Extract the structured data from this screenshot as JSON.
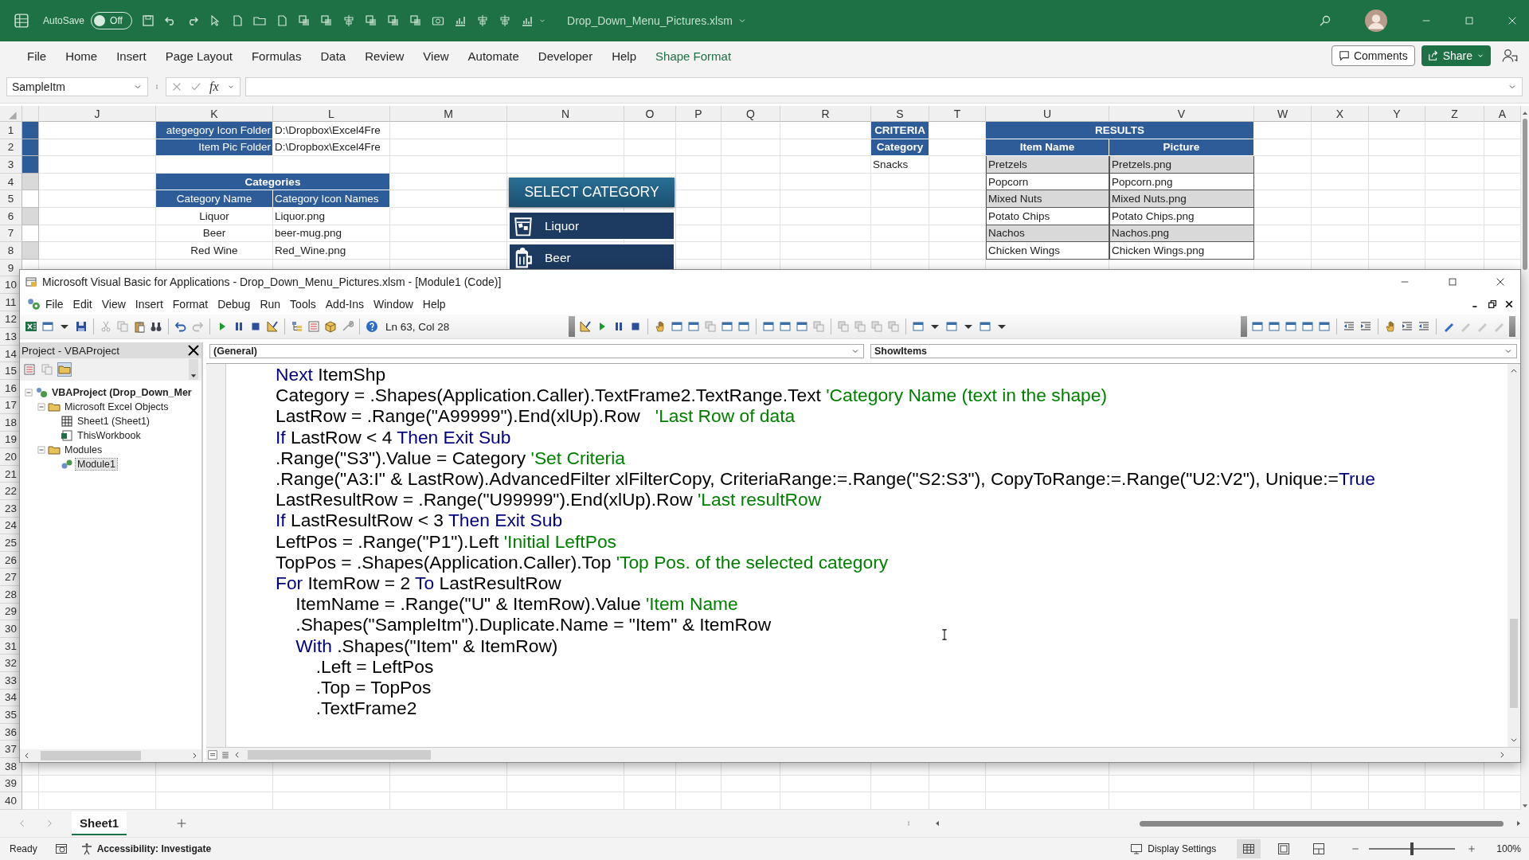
{
  "excel_window": {
    "autosave_label": "AutoSave",
    "autosave_state": "Off",
    "autosave_on": false,
    "file_name": "Drop_Down_Menu_Pictures.xlsm"
  },
  "ribbon_tabs": [
    {
      "label": "File",
      "kind": "standard"
    },
    {
      "label": "Home",
      "kind": "standard"
    },
    {
      "label": "Insert",
      "kind": "standard"
    },
    {
      "label": "Page Layout",
      "kind": "standard"
    },
    {
      "label": "Formulas",
      "kind": "standard"
    },
    {
      "label": "Data",
      "kind": "standard"
    },
    {
      "label": "Review",
      "kind": "standard"
    },
    {
      "label": "View",
      "kind": "standard"
    },
    {
      "label": "Automate",
      "kind": "standard"
    },
    {
      "label": "Developer",
      "kind": "standard"
    },
    {
      "label": "Help",
      "kind": "standard"
    },
    {
      "label": "Shape Format",
      "kind": "contextual"
    }
  ],
  "ribbon_buttons": {
    "comments": "Comments",
    "share": "Share"
  },
  "formula_bar": {
    "name_box": "SampleItm",
    "function_label": "fx"
  },
  "column_headers": [
    "J",
    "K",
    "L",
    "M",
    "N",
    "O",
    "P",
    "Q",
    "R",
    "S",
    "T",
    "U",
    "V",
    "W",
    "X",
    "Y",
    "Z",
    "A"
  ],
  "row_numbers": [
    "1",
    "2",
    "3",
    "4",
    "5",
    "6",
    "7",
    "8",
    "9",
    "10",
    "11",
    "12",
    "13",
    "14",
    "15",
    "16",
    "17",
    "18",
    "19",
    "20",
    "21",
    "22",
    "23",
    "24",
    "25",
    "26",
    "27",
    "28",
    "29",
    "30",
    "31",
    "32",
    "33",
    "34",
    "35",
    "36",
    "37",
    "38",
    "39",
    "40"
  ],
  "column_i_cells": [
    {
      "color": "#2e5c99"
    },
    {
      "color": "#2e5c99"
    },
    {
      "color": "#2e5c99"
    },
    {
      "color": "#d9d9d9"
    },
    {
      "color": "#ffffff"
    },
    {
      "color": "#d9d9d9"
    },
    {
      "color": "#ffffff"
    },
    {
      "color": "#d9d9d9"
    }
  ],
  "folders": [
    {
      "label": "ategegory Icon Folder",
      "path": "D:\\Dropbox\\Excel4Fre"
    },
    {
      "label": "Item Pic Folder",
      "path": "D:\\Dropbox\\Excel4Fre"
    }
  ],
  "categories_table": {
    "title": "Categories",
    "columns": [
      "Category Name",
      "Category Icon Names"
    ],
    "rows": [
      [
        "Liquor",
        "Liquor.png"
      ],
      [
        "Beer",
        "beer-mug.png"
      ],
      [
        "Red Wine",
        "Red_Wine.png"
      ]
    ]
  },
  "criteria": {
    "title": "CRITERIA",
    "field": "Category",
    "value": "Snacks"
  },
  "results_table": {
    "title": "RESULTS",
    "columns": [
      "Item Name",
      "Picture"
    ],
    "rows": [
      [
        "Pretzels",
        "Pretzels.png"
      ],
      [
        "Popcorn",
        "Popcorn.png"
      ],
      [
        "Mixed Nuts",
        "Mixed Nuts.png"
      ],
      [
        "Potato Chips",
        "Potato Chips.png"
      ],
      [
        "Nachos",
        "Nachos.png"
      ],
      [
        "Chicken Wings",
        "Chicken Wings.png"
      ]
    ]
  },
  "category_shapes": {
    "title": "SELECT CATEGORY",
    "items": [
      {
        "label": "Liquor",
        "kind": "glass"
      },
      {
        "label": "Beer",
        "kind": "mug"
      }
    ]
  },
  "vba_window": {
    "title": "Microsoft Visual Basic for Applications - Drop_Down_Menu_Pictures.xlsm - [Module1 (Code)]",
    "menu": [
      "File",
      "Edit",
      "View",
      "Insert",
      "Format",
      "Debug",
      "Run",
      "Tools",
      "Add-Ins",
      "Window",
      "Help"
    ],
    "position_field": "Ln 63, Col 28",
    "project_title": "Project - VBAProject",
    "tree": [
      {
        "label": "VBAProject (Drop_Down_Mer",
        "kind": "project",
        "expanded": true,
        "selected": false,
        "children": [
          {
            "label": "Microsoft Excel Objects",
            "kind": "folder",
            "expanded": true,
            "selected": false,
            "children": [
              {
                "label": "Sheet1 (Sheet1)",
                "kind": "sheet",
                "selected": false
              },
              {
                "label": "ThisWorkbook",
                "kind": "workbook",
                "selected": false
              }
            ]
          },
          {
            "label": "Modules",
            "kind": "folder",
            "expanded": true,
            "selected": false,
            "children": [
              {
                "label": "Module1",
                "kind": "module",
                "selected": true
              }
            ]
          }
        ]
      }
    ],
    "object_dropdown": "(General)",
    "procedure_dropdown": "ShowItems",
    "code_lines": [
      [
        {
          "kind": "keyword",
          "text": "Next"
        },
        {
          "kind": "plain",
          "text": " ItemShp"
        }
      ],
      [
        {
          "kind": "plain",
          "text": "Category = .Shapes(Application.Caller).TextFrame2.TextRange.Text "
        },
        {
          "kind": "comment",
          "text": "'Category Name (text in the shape)"
        }
      ],
      [
        {
          "kind": "plain",
          "text": "LastRow = .Range(\"A99999\").End(xlUp).Row   "
        },
        {
          "kind": "comment",
          "text": "'Last Row of data"
        }
      ],
      [
        {
          "kind": "keyword",
          "text": "If"
        },
        {
          "kind": "plain",
          "text": " LastRow < 4 "
        },
        {
          "kind": "keyword",
          "text": "Then Exit Sub"
        }
      ],
      [
        {
          "kind": "plain",
          "text": ".Range(\"S3\").Value = Category "
        },
        {
          "kind": "comment",
          "text": "'Set Criteria"
        }
      ],
      [
        {
          "kind": "plain",
          "text": ".Range(\"A3:I\" & LastRow).AdvancedFilter xlFilterCopy, CriteriaRange:=.Range(\"S2:S3\"), CopyToRange:=.Range(\"U2:V2\"), Unique:="
        },
        {
          "kind": "keyword",
          "text": "True"
        }
      ],
      [
        {
          "kind": "plain",
          "text": "LastResultRow = .Range(\"U99999\").End(xlUp).Row "
        },
        {
          "kind": "comment",
          "text": "'Last resultRow"
        }
      ],
      [
        {
          "kind": "keyword",
          "text": "If"
        },
        {
          "kind": "plain",
          "text": " LastResultRow < 3 "
        },
        {
          "kind": "keyword",
          "text": "Then Exit Sub"
        }
      ],
      [
        {
          "kind": "plain",
          "text": "LeftPos = .Range(\"P1\").Left "
        },
        {
          "kind": "comment",
          "text": "'Initial LeftPos"
        }
      ],
      [
        {
          "kind": "plain",
          "text": "TopPos = .Shapes(Application.Caller).Top "
        },
        {
          "kind": "comment",
          "text": "'Top Pos. of the selected category"
        }
      ],
      [
        {
          "kind": "keyword",
          "text": "For"
        },
        {
          "kind": "plain",
          "text": " ItemRow = 2 "
        },
        {
          "kind": "keyword",
          "text": "To"
        },
        {
          "kind": "plain",
          "text": " LastResultRow"
        }
      ],
      [
        {
          "kind": "plain",
          "text": "    ItemName = .Range(\"U\" & ItemRow).Value "
        },
        {
          "kind": "comment",
          "text": "'Item Name"
        }
      ],
      [
        {
          "kind": "plain",
          "text": "    .Shapes(\"SampleItm\").Duplicate.Name = \"Item\" & ItemRow"
        }
      ],
      [
        {
          "kind": "keyword",
          "text": "    With"
        },
        {
          "kind": "plain",
          "text": " .Shapes(\"Item\" & ItemRow)"
        }
      ],
      [
        {
          "kind": "plain",
          "text": "        .Left = LeftPos"
        }
      ],
      [
        {
          "kind": "plain",
          "text": "        .Top = TopPos"
        }
      ],
      [
        {
          "kind": "plain",
          "text": "        .TextFrame2"
        }
      ]
    ]
  },
  "sheet_tabs": [
    {
      "label": "Sheet1",
      "selected": true
    }
  ],
  "status_bar": {
    "ready": "Ready",
    "accessibility": "Accessibility: Investigate",
    "display_settings": "Display Settings",
    "views": [
      {
        "kind": "normal",
        "selected": true
      },
      {
        "kind": "page_layout",
        "selected": false
      },
      {
        "kind": "page_break",
        "selected": false
      }
    ],
    "zoom": {
      "level": 0.5,
      "reading": "100%"
    }
  }
}
